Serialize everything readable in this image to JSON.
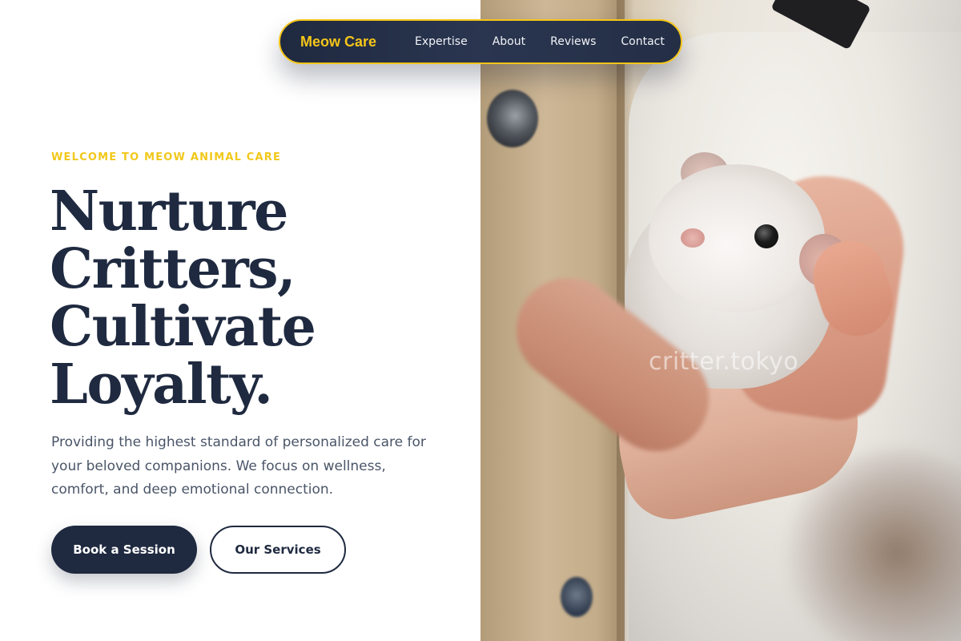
{
  "nav": {
    "brand": "Meow Care",
    "links": [
      "Expertise",
      "About",
      "Reviews",
      "Contact"
    ]
  },
  "hero": {
    "eyebrow": "WELCOME TO MEOW ANIMAL CARE",
    "headline": [
      "Nurture",
      "Critters,",
      "Cultivate",
      "Loyalty."
    ],
    "lead": "Providing the highest standard of personalized care for your beloved companions. We focus on wellness, comfort, and deep emotional connection.",
    "primary_cta": "Book a Session",
    "secondary_cta": "Our Services"
  },
  "image": {
    "watermark": "critter.tokyo"
  },
  "colors": {
    "navy": "#1f2a40",
    "accent_yellow": "#f5c518",
    "body_text": "#4a5568",
    "background": "#ffffff"
  }
}
